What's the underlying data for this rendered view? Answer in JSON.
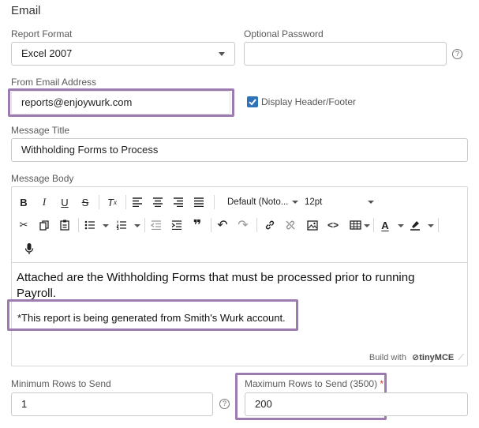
{
  "section": {
    "title": "Email"
  },
  "report_format": {
    "label": "Report Format",
    "value": "Excel 2007"
  },
  "password": {
    "label": "Optional Password",
    "value": "",
    "help": "?"
  },
  "from_email": {
    "label": "From Email Address",
    "value": "reports@enjoywurk.com"
  },
  "header_footer": {
    "label": "Display Header/Footer",
    "checked": true
  },
  "message_title": {
    "label": "Message Title",
    "value": "Withholding Forms to Process"
  },
  "message_body": {
    "label": "Message Body",
    "font_family": "Default (Noto...",
    "font_size": "12pt",
    "paragraph1": "Attached are the Withholding Forms that must be processed prior to running Payroll.",
    "paragraph2": "*This report is being generated from Smith's Wurk account.",
    "branding": "Build with",
    "brand_name": "tinyMCE"
  },
  "min_rows": {
    "label": "Minimum Rows to Send",
    "value": "1",
    "help": "?"
  },
  "max_rows": {
    "label": "Maximum Rows to Send (3500)",
    "required_mark": "*",
    "value": "200"
  },
  "colors": {
    "accent": "#2e73b8",
    "highlight": "#9b7bb0",
    "required": "#d0312d"
  }
}
